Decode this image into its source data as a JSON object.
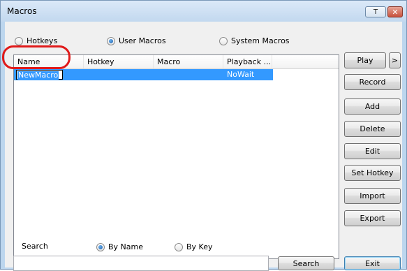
{
  "window": {
    "title": "Macros",
    "help_glyph": "T",
    "close_glyph": "✕"
  },
  "mode_options": {
    "hotkeys": "Hotkeys",
    "user_macros": "User Macros",
    "system_macros": "System Macros",
    "selected": "User Macros"
  },
  "table": {
    "columns": [
      "Name",
      "Hotkey",
      "Macro",
      "Playback ..."
    ],
    "rows": [
      {
        "name": "NewMacro",
        "hotkey": "",
        "macro": "",
        "playback": "NoWait"
      }
    ]
  },
  "buttons": {
    "play": "Play",
    "play_more": ">",
    "record": "Record",
    "add": "Add",
    "delete": "Delete",
    "edit": "Edit",
    "set_hotkey": "Set Hotkey",
    "import": "Import",
    "export": "Export",
    "search": "Search",
    "exit": "Exit"
  },
  "search": {
    "label": "Search",
    "by_name": "By Name",
    "by_key": "By Key",
    "selected": "By Name",
    "value": ""
  },
  "colors": {
    "selection": "#3399ff",
    "annotation": "#e01a1a",
    "frame": "#bcd6ee"
  }
}
